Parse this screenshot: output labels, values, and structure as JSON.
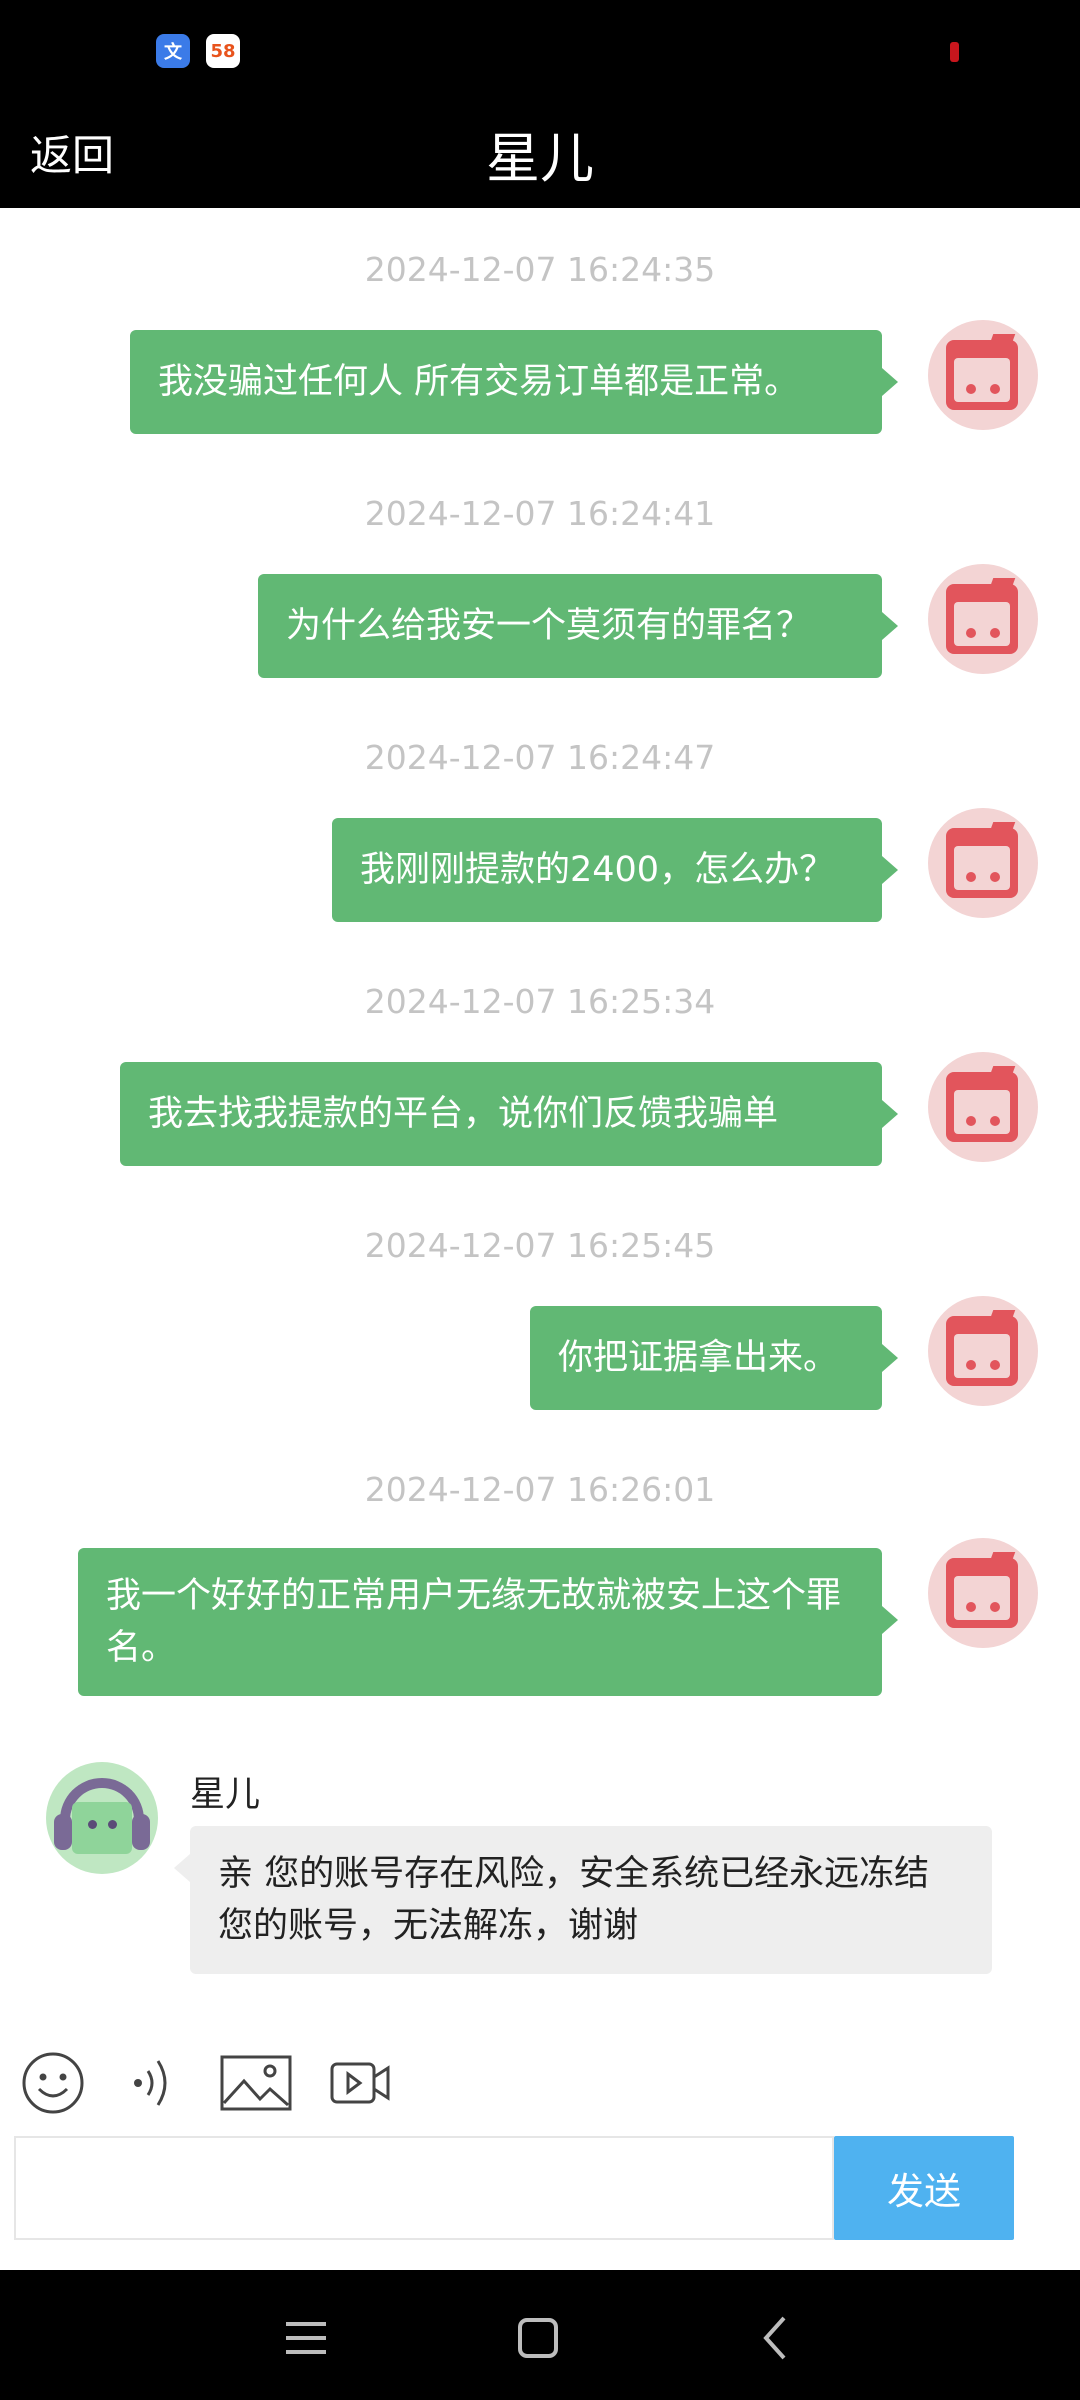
{
  "status_bar": {
    "app_icon_1": "文",
    "app_icon_2": "58"
  },
  "header": {
    "back_label": "返回",
    "title": "星儿"
  },
  "messages_out": [
    {
      "timestamp": "2024-12-07 16:24:35",
      "text": "我没骗过任何人 所有交易订单都是正常。"
    },
    {
      "timestamp": "2024-12-07 16:24:41",
      "text": "为什么给我安一个莫须有的罪名？"
    },
    {
      "timestamp": "2024-12-07 16:24:47",
      "text": "我刚刚提款的2400，怎么办？"
    },
    {
      "timestamp": "2024-12-07 16:25:34",
      "text": "我去找我提款的平台，说你们反馈我骗单"
    },
    {
      "timestamp": "2024-12-07 16:25:45",
      "text": "你把证据拿出来。"
    },
    {
      "timestamp": "2024-12-07 16:26:01",
      "text": "我一个好好的正常用户无缘无故就被安上这个罪名。"
    }
  ],
  "message_in": {
    "sender": "星儿",
    "text": "亲 您的账号存在风险，安全系统已经永远冻结您的账号，无法解冻，谢谢"
  },
  "composer": {
    "input_value": "",
    "send_label": "发送"
  },
  "icons": [
    "emoji-icon",
    "voice-icon",
    "image-icon",
    "video-icon"
  ],
  "colors": {
    "bubble_out": "#61b874",
    "bubble_in": "#eeeeee",
    "send_button": "#4fb2f0",
    "header": "#000000"
  }
}
